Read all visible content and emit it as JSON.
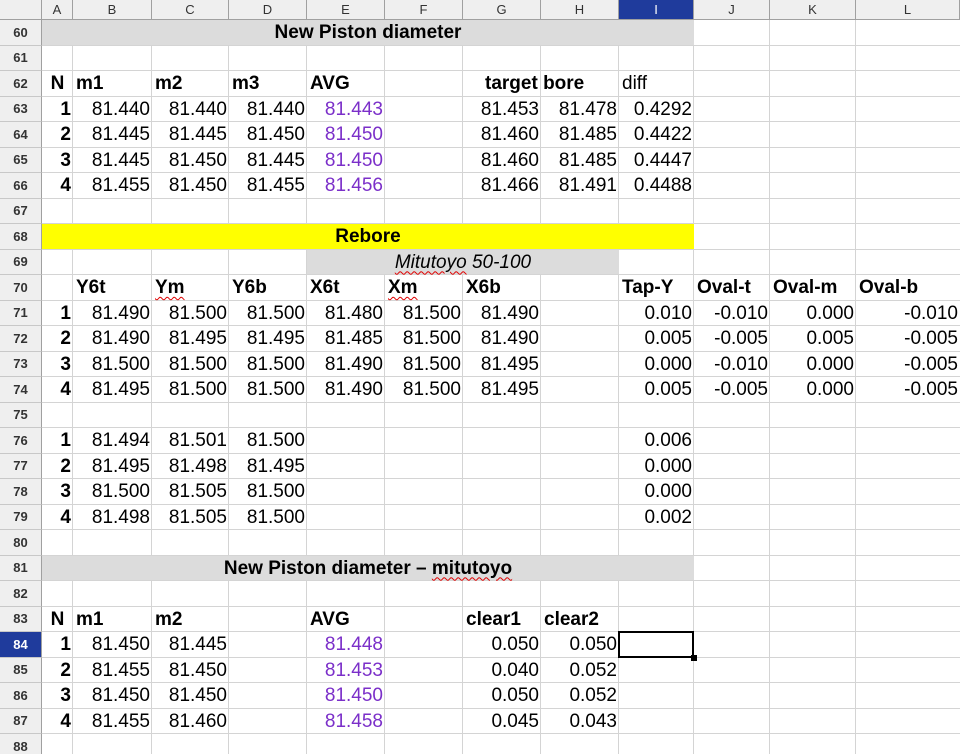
{
  "columns": [
    "A",
    "B",
    "C",
    "D",
    "E",
    "F",
    "G",
    "H",
    "I",
    "J",
    "K",
    "L"
  ],
  "selected_column": "I",
  "selected_row": "84",
  "rows": [
    "60",
    "61",
    "62",
    "63",
    "64",
    "65",
    "66",
    "67",
    "68",
    "69",
    "70",
    "71",
    "72",
    "73",
    "74",
    "75",
    "76",
    "77",
    "78",
    "79",
    "80",
    "81",
    "82",
    "83",
    "84",
    "85",
    "86",
    "87",
    "88"
  ],
  "colors": {
    "header_selected": "#1f3b9c",
    "rebore_band": "#ffff00",
    "title_band": "#dcdcdc",
    "avg_value": "#7b2fc9"
  },
  "section1": {
    "title": "New Piston diameter",
    "header": {
      "n": "N",
      "m1": "m1",
      "m2": "m2",
      "m3": "m3",
      "avg": "AVG",
      "target": "target bore",
      "diff": "diff"
    },
    "rows": [
      {
        "n": "1",
        "m1": "81.440",
        "m2": "81.440",
        "m3": "81.440",
        "avg": "81.443",
        "g": "81.453",
        "h": "81.478",
        "diff": "0.4292"
      },
      {
        "n": "2",
        "m1": "81.445",
        "m2": "81.445",
        "m3": "81.450",
        "avg": "81.450",
        "g": "81.460",
        "h": "81.485",
        "diff": "0.4422"
      },
      {
        "n": "3",
        "m1": "81.445",
        "m2": "81.450",
        "m3": "81.445",
        "avg": "81.450",
        "g": "81.460",
        "h": "81.485",
        "diff": "0.4447"
      },
      {
        "n": "4",
        "m1": "81.455",
        "m2": "81.450",
        "m3": "81.455",
        "avg": "81.456",
        "g": "81.466",
        "h": "81.491",
        "diff": "0.4488"
      }
    ]
  },
  "section2": {
    "title": "Rebore",
    "subtitle": "Mitutoyo 50-100",
    "header": {
      "y6t": "Y6t",
      "ym": "Ym",
      "y6b": "Y6b",
      "x6t": "X6t",
      "xm": "Xm",
      "x6b": "X6b",
      "tapy": "Tap-Y",
      "ovalt": "Oval-t",
      "ovalm": "Oval-m",
      "ovalb": "Oval-b"
    },
    "rows": [
      {
        "n": "1",
        "y6t": "81.490",
        "ym": "81.500",
        "y6b": "81.500",
        "x6t": "81.480",
        "xm": "81.500",
        "x6b": "81.490",
        "tapy": "0.010",
        "ovalt": "-0.010",
        "ovalm": "0.000",
        "ovalb": "-0.010"
      },
      {
        "n": "2",
        "y6t": "81.490",
        "ym": "81.495",
        "y6b": "81.495",
        "x6t": "81.485",
        "xm": "81.500",
        "x6b": "81.490",
        "tapy": "0.005",
        "ovalt": "-0.005",
        "ovalm": "0.005",
        "ovalb": "-0.005"
      },
      {
        "n": "3",
        "y6t": "81.500",
        "ym": "81.500",
        "y6b": "81.500",
        "x6t": "81.490",
        "xm": "81.500",
        "x6b": "81.495",
        "tapy": "0.000",
        "ovalt": "-0.010",
        "ovalm": "0.000",
        "ovalb": "-0.005"
      },
      {
        "n": "4",
        "y6t": "81.495",
        "ym": "81.500",
        "y6b": "81.500",
        "x6t": "81.490",
        "xm": "81.500",
        "x6b": "81.495",
        "tapy": "0.005",
        "ovalt": "-0.005",
        "ovalm": "0.000",
        "ovalb": "-0.005"
      }
    ],
    "rows2": [
      {
        "n": "1",
        "b": "81.494",
        "c": "81.501",
        "d": "81.500",
        "i": "0.006"
      },
      {
        "n": "2",
        "b": "81.495",
        "c": "81.498",
        "d": "81.495",
        "i": "0.000"
      },
      {
        "n": "3",
        "b": "81.500",
        "c": "81.505",
        "d": "81.500",
        "i": "0.000"
      },
      {
        "n": "4",
        "b": "81.498",
        "c": "81.505",
        "d": "81.500",
        "i": "0.002"
      }
    ]
  },
  "section3": {
    "title": "New Piston diameter – mitutoyo",
    "header": {
      "n": "N",
      "m1": "m1",
      "m2": "m2",
      "avg": "AVG",
      "clear1": "clear1",
      "clear2": "clear2"
    },
    "rows": [
      {
        "n": "1",
        "m1": "81.450",
        "m2": "81.445",
        "avg": "81.448",
        "clear1": "0.050",
        "clear2": "0.050"
      },
      {
        "n": "2",
        "m1": "81.455",
        "m2": "81.450",
        "avg": "81.453",
        "clear1": "0.040",
        "clear2": "0.052"
      },
      {
        "n": "3",
        "m1": "81.450",
        "m2": "81.450",
        "avg": "81.450",
        "clear1": "0.050",
        "clear2": "0.052"
      },
      {
        "n": "4",
        "m1": "81.455",
        "m2": "81.460",
        "avg": "81.458",
        "clear1": "0.045",
        "clear2": "0.043"
      }
    ]
  }
}
